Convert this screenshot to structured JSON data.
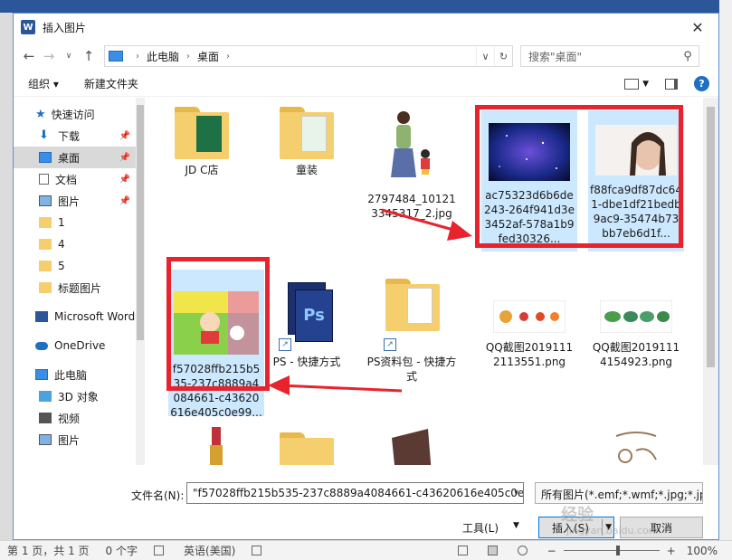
{
  "dialog": {
    "title": "插入图片",
    "app_icon_letter": "W"
  },
  "nav": {
    "breadcrumb": [
      "此电脑",
      "桌面"
    ],
    "search_placeholder": "搜索\"桌面\""
  },
  "toolbar": {
    "organize": "组织",
    "new_folder": "新建文件夹",
    "help": "?"
  },
  "sidebar": {
    "items": [
      {
        "label": "快速访问"
      },
      {
        "label": "下载"
      },
      {
        "label": "桌面"
      },
      {
        "label": "文档"
      },
      {
        "label": "图片"
      },
      {
        "label": "1"
      },
      {
        "label": "4"
      },
      {
        "label": "5"
      },
      {
        "label": "标题图片"
      },
      {
        "label": "Microsoft Word"
      },
      {
        "label": "OneDrive"
      },
      {
        "label": "此电脑"
      },
      {
        "label": "3D 对象"
      },
      {
        "label": "视频"
      },
      {
        "label": "图片"
      }
    ]
  },
  "files": [
    {
      "label": "JD C店"
    },
    {
      "label": "童装"
    },
    {
      "label": "2797484_101213345317_2.jpg"
    },
    {
      "label": "ac75323d6b6de243-264f941d3e3452af-578a1b9fed30326..."
    },
    {
      "label": "f88fca9df87dc641-dbe1df21bedb9ac9-35474b73bb7eb6d1f..."
    },
    {
      "label": "f57028ffb215b535-237c8889a4084661-c43620616e405c0e99..."
    },
    {
      "label": "PS - 快捷方式"
    },
    {
      "label": "PS资料包 - 快捷方式"
    },
    {
      "label": "QQ截图20191112113551.png"
    },
    {
      "label": "QQ截图20191114154923.png"
    }
  ],
  "footer": {
    "filename_label": "文件名(N):",
    "filename_value": "\"f57028ffb215b535-237c8889a4084661-c43620616e405c0e9",
    "filetype_value": "所有图片(*.emf;*.wmf;*.jpg;*.jp",
    "tools_label": "工具(L)",
    "insert_label": "插入(S)",
    "cancel_label": "取消"
  },
  "status": {
    "page": "第 1 页，共 1 页",
    "words": "0 个字",
    "language": "英语(美国)",
    "zoom": "100%",
    "zoom_level": 100
  },
  "watermark": {
    "text": "经验",
    "url": "jingyan.baidu.com"
  },
  "colors": {
    "accent": "#0078d7",
    "selection": "#cce8ff",
    "highlight_red": "#e8232e",
    "word_blue": "#2b579a"
  }
}
